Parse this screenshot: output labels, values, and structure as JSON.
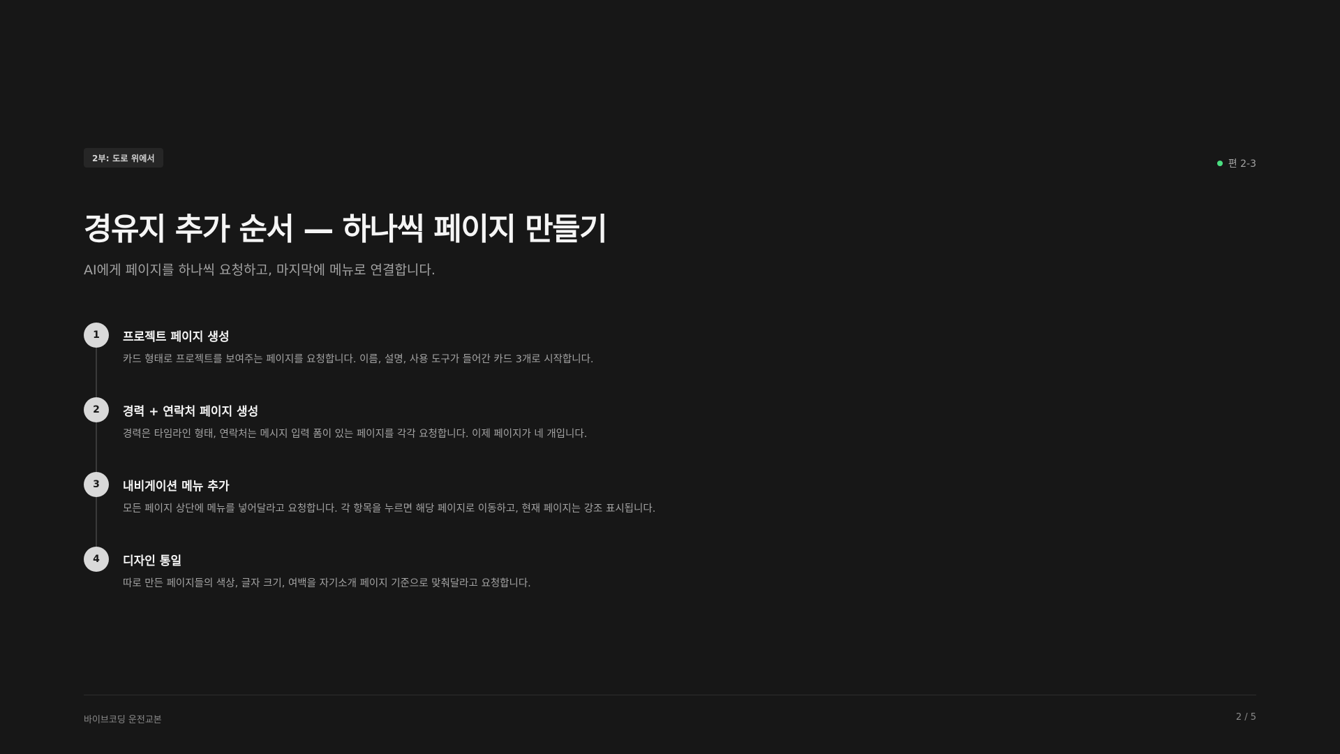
{
  "header": {
    "section_tag": "2부: 도로 위에서",
    "episode_label": "편 2-3"
  },
  "title": "경유지 추가 순서 — 하나씩 페이지 만들기",
  "subtitle": "AI에게 페이지를 하나씩 요청하고, 마지막에 메뉴로 연결합니다.",
  "steps": [
    {
      "number": "1",
      "title": "프로젝트 페이지 생성",
      "description": "카드 형태로 프로젝트를 보여주는 페이지를 요청합니다. 이름, 설명, 사용 도구가 들어간 카드 3개로 시작합니다."
    },
    {
      "number": "2",
      "title": "경력 + 연락처 페이지 생성",
      "description": "경력은 타임라인 형태, 연락처는 메시지 입력 폼이 있는 페이지를 각각 요청합니다. 이제 페이지가 네 개입니다."
    },
    {
      "number": "3",
      "title": "내비게이션 메뉴 추가",
      "description": "모든 페이지 상단에 메뉴를 넣어달라고 요청합니다. 각 항목을 누르면 해당 페이지로 이동하고, 현재 페이지는 강조 표시됩니다."
    },
    {
      "number": "4",
      "title": "디자인 통일",
      "description": "따로 만든 페이지들의 색상, 글자 크기, 여백을 자기소개 페이지 기준으로 맞춰달라고 요청합니다."
    }
  ],
  "footer": {
    "book_title": "바이브코딩 운전교본",
    "page_indicator": "2 / 5"
  },
  "colors": {
    "background": "#171717",
    "accent_dot": "#4ade80",
    "step_badge": "#d9d9d9"
  }
}
